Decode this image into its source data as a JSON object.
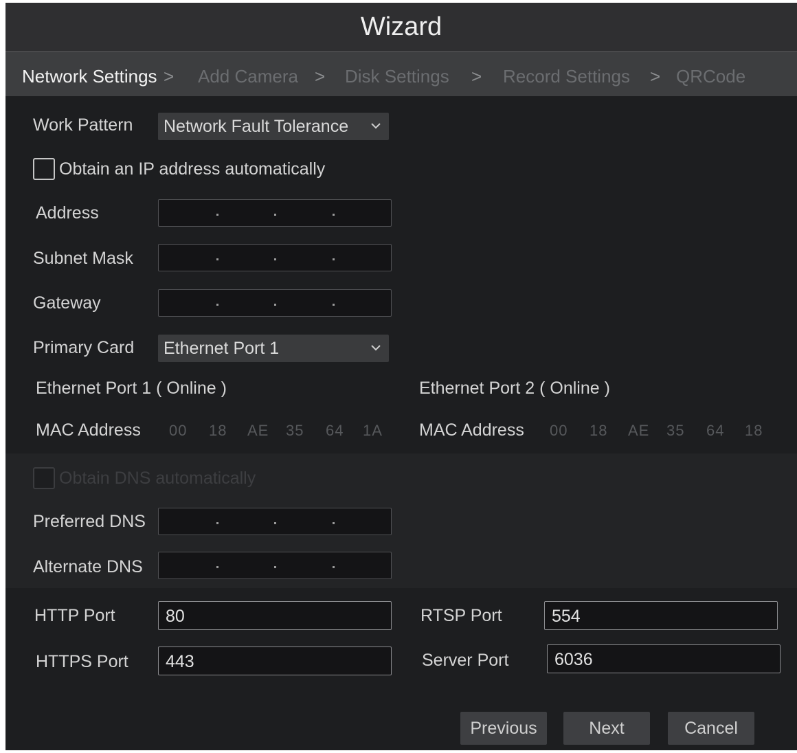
{
  "window": {
    "title": "Wizard"
  },
  "steps": [
    {
      "label": "Network Settings",
      "active": true
    },
    {
      "label": "Add Camera",
      "active": false
    },
    {
      "label": "Disk Settings",
      "active": false
    },
    {
      "label": "Record Settings",
      "active": false
    },
    {
      "label": "QRCode",
      "active": false
    }
  ],
  "step_separator": ">",
  "form": {
    "work_pattern": {
      "label": "Work Pattern",
      "value": "Network Fault Tolerance"
    },
    "obtain_ip": {
      "label": "Obtain an IP address automatically",
      "checked": false
    },
    "address": {
      "label": "Address"
    },
    "subnet_mask": {
      "label": "Subnet Mask"
    },
    "gateway": {
      "label": "Gateway"
    },
    "primary_card": {
      "label": "Primary Card",
      "value": "Ethernet Port 1"
    },
    "port1": {
      "title": "Ethernet Port 1 ( Online )",
      "mac_label": "MAC Address",
      "mac": [
        "00",
        "18",
        "AE",
        "35",
        "64",
        "1A"
      ]
    },
    "port2": {
      "title": "Ethernet Port 2 ( Online )",
      "mac_label": "MAC Address",
      "mac": [
        "00",
        "18",
        "AE",
        "35",
        "64",
        "18"
      ]
    },
    "obtain_dns": {
      "label": "Obtain DNS automatically",
      "checked": false,
      "disabled": true
    },
    "preferred_dns": {
      "label": "Preferred DNS"
    },
    "alternate_dns": {
      "label": "Alternate DNS"
    },
    "http_port": {
      "label": "HTTP Port",
      "value": "80"
    },
    "https_port": {
      "label": "HTTPS Port",
      "value": "443"
    },
    "rtsp_port": {
      "label": "RTSP Port",
      "value": "554"
    },
    "server_port": {
      "label": "Server Port",
      "value": "6036"
    }
  },
  "buttons": {
    "previous": "Previous",
    "next": "Next",
    "cancel": "Cancel"
  },
  "colors": {
    "background": "#1d1e20",
    "titlebar": "#2f2f31",
    "breadcrumb_bar": "#3d3e40",
    "active_step": "#f2f2f2",
    "inactive_step": "#6b6d70"
  },
  "icons": {
    "dropdown": "chevron-down-icon",
    "checkbox": "checkbox-icon"
  }
}
